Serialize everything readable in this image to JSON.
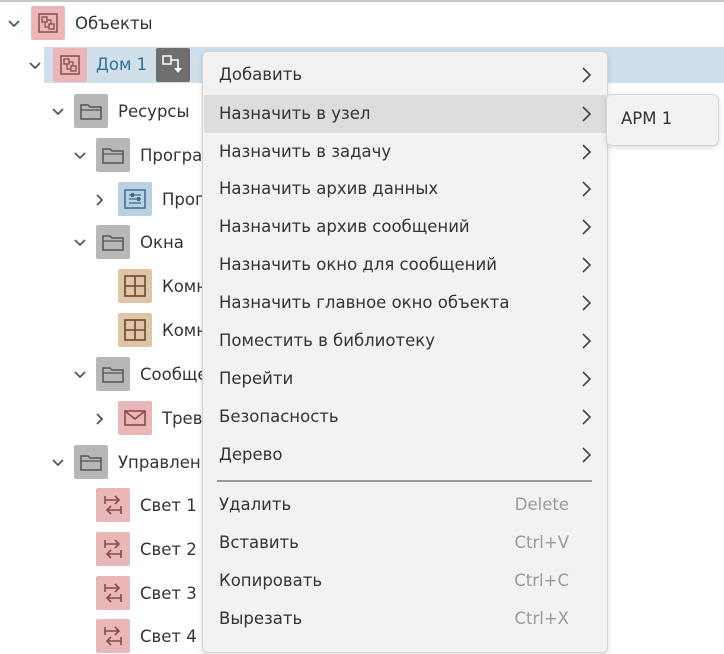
{
  "tree": {
    "items": [
      {
        "label": "Объекты",
        "icon": "objects-icon",
        "expanded": true
      },
      {
        "label": "Дом 1",
        "icon": "objects-icon",
        "expanded": true,
        "selected": true
      },
      {
        "label": "Ресурсы",
        "icon": "folder-icon",
        "expanded": true
      },
      {
        "label": "Програ",
        "icon": "folder-icon",
        "expanded": true
      },
      {
        "label": "Прог",
        "icon": "program-icon",
        "expanded": false
      },
      {
        "label": "Окна",
        "icon": "folder-icon",
        "expanded": true
      },
      {
        "label": "Комн",
        "icon": "window-icon"
      },
      {
        "label": "Комн",
        "icon": "window-icon"
      },
      {
        "label": "Сообще",
        "icon": "folder-icon",
        "expanded": true
      },
      {
        "label": "Трев",
        "icon": "envelope-icon",
        "expanded": false
      },
      {
        "label": "Управлени",
        "icon": "folder-icon",
        "expanded": true
      },
      {
        "label": "Свет 1",
        "icon": "switch-icon"
      },
      {
        "label": "Свет 2",
        "icon": "switch-icon"
      },
      {
        "label": "Свет 3",
        "icon": "switch-icon"
      },
      {
        "label": "Свет 4",
        "icon": "switch-icon"
      }
    ],
    "action_icon": "assign-node-icon"
  },
  "context_menu": {
    "items": [
      {
        "label": "Добавить",
        "has_submenu": true
      },
      {
        "label": "Назначить в узел",
        "has_submenu": true,
        "highlighted": true
      },
      {
        "label": "Назначить в задачу",
        "has_submenu": true
      },
      {
        "label": "Назначить архив данных",
        "has_submenu": true
      },
      {
        "label": "Назначить архив сообщений",
        "has_submenu": true
      },
      {
        "label": "Назначить окно для сообщений",
        "has_submenu": true
      },
      {
        "label": "Назначить главное окно объекта",
        "has_submenu": true
      },
      {
        "label": "Поместить в библиотеку",
        "has_submenu": true
      },
      {
        "label": "Перейти",
        "has_submenu": true
      },
      {
        "label": "Безопасность",
        "has_submenu": true
      },
      {
        "label": "Дерево",
        "has_submenu": true
      }
    ],
    "edit_items": [
      {
        "label": "Удалить",
        "shortcut": "Delete"
      },
      {
        "label": "Вставить",
        "shortcut": "Ctrl+V"
      },
      {
        "label": "Копировать",
        "shortcut": "Ctrl+C"
      },
      {
        "label": "Вырезать",
        "shortcut": "Ctrl+X"
      }
    ]
  },
  "submenu": {
    "items": [
      {
        "label": "АРМ 1"
      }
    ]
  },
  "colors": {
    "selection": "#cfe0ea",
    "selected_text": "#2f6f9c",
    "menu_bg": "#f2f2f2",
    "menu_highlight": "#dddddd",
    "shortcut_text": "#9a9a9a"
  }
}
